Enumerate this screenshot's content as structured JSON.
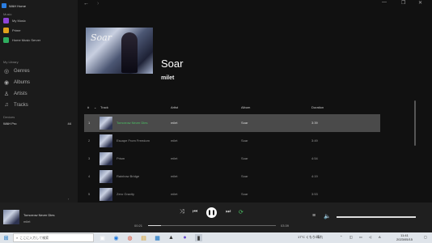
{
  "app": {
    "title": "WAH Home"
  },
  "sidebar": {
    "sources_label": "Music",
    "sources": [
      {
        "label": "My Music",
        "color": "#8e44d8",
        "icon": "music-library-icon"
      },
      {
        "label": "Prime",
        "color": "#e0a21b",
        "icon": "prime-icon"
      },
      {
        "label": "Home Music Server",
        "color": "#2fae5f",
        "icon": "server-icon"
      }
    ],
    "library_label": "My Library",
    "library": [
      {
        "label": "Genres",
        "icon": "genres-icon"
      },
      {
        "label": "Albums",
        "icon": "albums-icon"
      },
      {
        "label": "Artists",
        "icon": "artists-icon"
      },
      {
        "label": "Tracks",
        "icon": "tracks-icon"
      }
    ],
    "devices_label": "Devices",
    "device": {
      "name": "WAH Pro",
      "count": "44"
    }
  },
  "album": {
    "art_text": "Soar",
    "title": "Soar",
    "artist": "milet"
  },
  "table": {
    "headers": {
      "num": "#",
      "track": "Track",
      "artist": "Artist",
      "album": "Album",
      "duration": "Duration"
    },
    "rows": [
      {
        "num": "1",
        "title": "Tomorrow Never Dies",
        "artist": "milet",
        "album": "Soar",
        "duration": "3:39",
        "selected": true
      },
      {
        "num": "2",
        "title": "Escape From Freedom",
        "artist": "milet",
        "album": "Soar",
        "duration": "3:49"
      },
      {
        "num": "3",
        "title": "Prism",
        "artist": "milet",
        "album": "Soar",
        "duration": "4:54"
      },
      {
        "num": "4",
        "title": "Rainbow Bridge",
        "artist": "milet",
        "album": "Soar",
        "duration": "4:19"
      },
      {
        "num": "5",
        "title": "Zero Gravity",
        "artist": "milet",
        "album": "Soar",
        "duration": "3:53"
      }
    ]
  },
  "player": {
    "title": "Tomorrow Never Dies",
    "artist": "milet",
    "elapsed": "00:21",
    "total": "03:39",
    "progress": 0.1
  },
  "taskbar": {
    "search_placeholder": "ここに入力して検索",
    "weather": "17°C くもり/晴れ",
    "time": "11:41",
    "date": "2023/05/15",
    "ime": "A"
  },
  "colors": {
    "accent": "#4cc164",
    "selected_row": "#4a4a4a"
  }
}
